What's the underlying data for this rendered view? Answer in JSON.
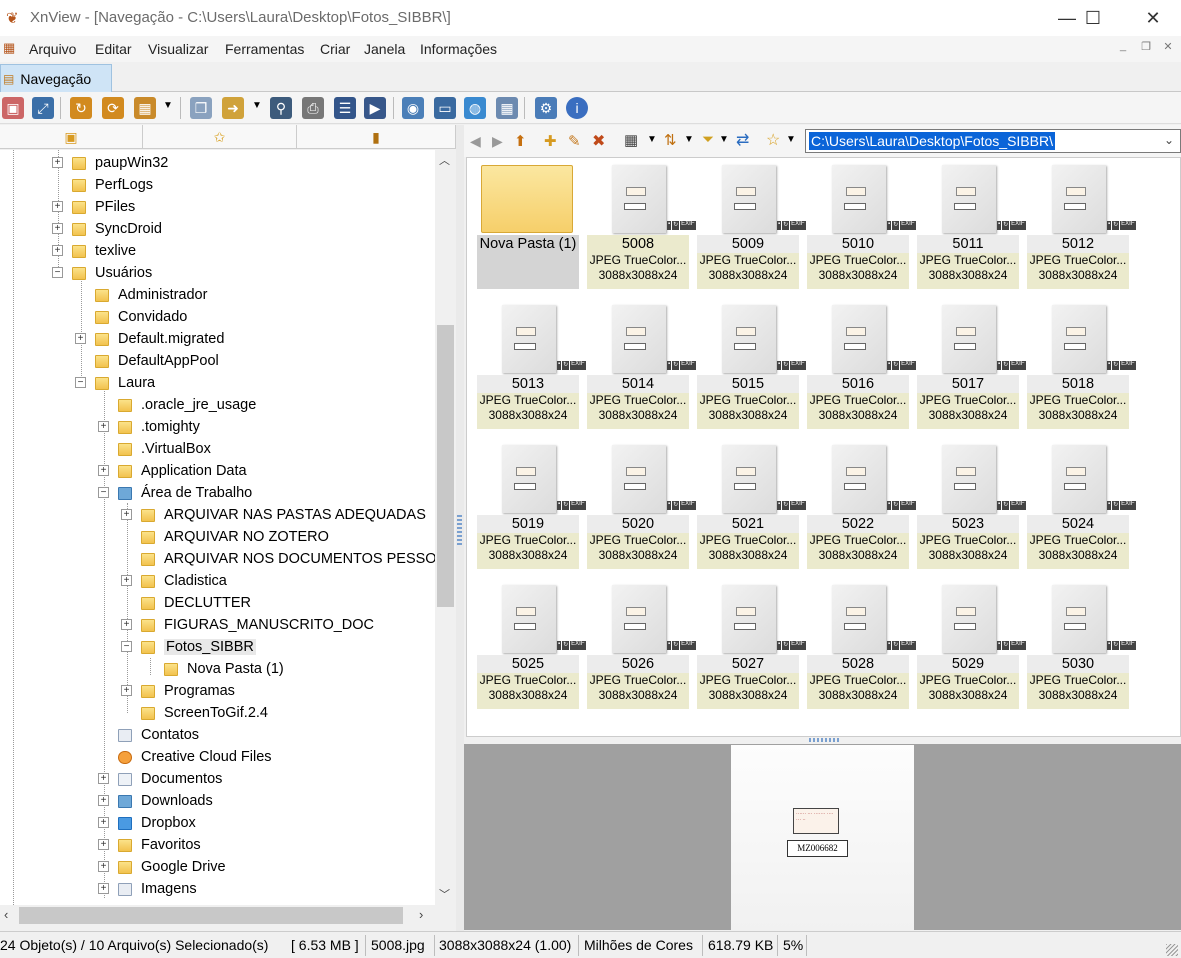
{
  "window": {
    "title": "XnView - [Navegação - C:\\Users\\Laura\\Desktop\\Fotos_SIBBR\\]",
    "minimize": "—",
    "maximize": "☐",
    "close": "✕"
  },
  "menu": [
    "Arquivo",
    "Editar",
    "Visualizar",
    "Ferramentas",
    "Criar",
    "Janela",
    "Informações"
  ],
  "mdi": {
    "minimize": "_",
    "restore": "❐",
    "close": "✕"
  },
  "tab": {
    "label": "Navegação"
  },
  "path": "C:\\Users\\Laura\\Desktop\\Fotos_SIBBR\\",
  "tree": [
    {
      "label": "paupWin32",
      "expander": "+"
    },
    {
      "label": "PerfLogs",
      "expander": ""
    },
    {
      "label": "PFiles",
      "expander": "+"
    },
    {
      "label": "SyncDroid",
      "expander": "+"
    },
    {
      "label": "texlive",
      "expander": "+"
    },
    {
      "label": "Usuários",
      "expander": "−"
    },
    {
      "label": "Administrador",
      "expander": ""
    },
    {
      "label": "Convidado",
      "expander": ""
    },
    {
      "label": "Default.migrated",
      "expander": "+"
    },
    {
      "label": "DefaultAppPool",
      "expander": ""
    },
    {
      "label": "Laura",
      "expander": "−"
    },
    {
      "label": ".oracle_jre_usage",
      "expander": ""
    },
    {
      "label": ".tomighty",
      "expander": "+"
    },
    {
      "label": ".VirtualBox",
      "expander": ""
    },
    {
      "label": "Application Data",
      "expander": "+"
    },
    {
      "label": "Área de Trabalho",
      "expander": "−"
    },
    {
      "label": "ARQUIVAR NAS PASTAS ADEQUADAS",
      "expander": "+"
    },
    {
      "label": "ARQUIVAR NO ZOTERO",
      "expander": ""
    },
    {
      "label": "ARQUIVAR NOS DOCUMENTOS PESSOAIS",
      "expander": ""
    },
    {
      "label": "Cladistica",
      "expander": "+"
    },
    {
      "label": "DECLUTTER",
      "expander": ""
    },
    {
      "label": "FIGURAS_MANUSCRITO_DOC",
      "expander": "+"
    },
    {
      "label": "Fotos_SIBBR",
      "expander": "−"
    },
    {
      "label": "Nova Pasta (1)",
      "expander": ""
    },
    {
      "label": "Programas",
      "expander": "+"
    },
    {
      "label": "ScreenToGif.2.4",
      "expander": ""
    },
    {
      "label": "Contatos",
      "expander": ""
    },
    {
      "label": "Creative Cloud Files",
      "expander": ""
    },
    {
      "label": "Documentos",
      "expander": "+"
    },
    {
      "label": "Downloads",
      "expander": "+"
    },
    {
      "label": "Dropbox",
      "expander": "+"
    },
    {
      "label": "Favoritos",
      "expander": "+"
    },
    {
      "label": "Google Drive",
      "expander": "+"
    },
    {
      "label": "Imagens",
      "expander": "+"
    }
  ],
  "folder_item": {
    "name": "Nova Pasta (1)"
  },
  "files": [
    {
      "name": "5008",
      "type": "JPEG TrueColor...",
      "dims": "3088x3088x24"
    },
    {
      "name": "5009",
      "type": "JPEG TrueColor...",
      "dims": "3088x3088x24"
    },
    {
      "name": "5010",
      "type": "JPEG TrueColor...",
      "dims": "3088x3088x24"
    },
    {
      "name": "5011",
      "type": "JPEG TrueColor...",
      "dims": "3088x3088x24"
    },
    {
      "name": "5012",
      "type": "JPEG TrueColor...",
      "dims": "3088x3088x24"
    },
    {
      "name": "5013",
      "type": "JPEG TrueColor...",
      "dims": "3088x3088x24"
    },
    {
      "name": "5014",
      "type": "JPEG TrueColor...",
      "dims": "3088x3088x24"
    },
    {
      "name": "5015",
      "type": "JPEG TrueColor...",
      "dims": "3088x3088x24"
    },
    {
      "name": "5016",
      "type": "JPEG TrueColor...",
      "dims": "3088x3088x24"
    },
    {
      "name": "5017",
      "type": "JPEG TrueColor...",
      "dims": "3088x3088x24"
    },
    {
      "name": "5018",
      "type": "JPEG TrueColor...",
      "dims": "3088x3088x24"
    },
    {
      "name": "5019",
      "type": "JPEG TrueColor...",
      "dims": "3088x3088x24"
    },
    {
      "name": "5020",
      "type": "JPEG TrueColor...",
      "dims": "3088x3088x24"
    },
    {
      "name": "5021",
      "type": "JPEG TrueColor...",
      "dims": "3088x3088x24"
    },
    {
      "name": "5022",
      "type": "JPEG TrueColor...",
      "dims": "3088x3088x24"
    },
    {
      "name": "5023",
      "type": "JPEG TrueColor...",
      "dims": "3088x3088x24"
    },
    {
      "name": "5024",
      "type": "JPEG TrueColor...",
      "dims": "3088x3088x24"
    },
    {
      "name": "5025",
      "type": "JPEG TrueColor...",
      "dims": "3088x3088x24"
    },
    {
      "name": "5026",
      "type": "JPEG TrueColor...",
      "dims": "3088x3088x24"
    },
    {
      "name": "5027",
      "type": "JPEG TrueColor...",
      "dims": "3088x3088x24"
    },
    {
      "name": "5028",
      "type": "JPEG TrueColor...",
      "dims": "3088x3088x24"
    },
    {
      "name": "5029",
      "type": "JPEG TrueColor...",
      "dims": "3088x3088x24"
    },
    {
      "name": "5030",
      "type": "JPEG TrueColor...",
      "dims": "3088x3088x24"
    }
  ],
  "badge": {
    "exif": "EXIF"
  },
  "preview": {
    "label_text": "MZ006682"
  },
  "status": {
    "objects": "24 Objeto(s) / 10 Arquivo(s) Selecionado(s)",
    "size": "[ 6.53 MB ]",
    "file": "5008.jpg",
    "dims": "3088x3088x24 (1.00)",
    "colors": "Milhões de Cores",
    "filesize": "618.79 KB",
    "zoom": "5%"
  },
  "colors": {
    "accent": "#0a64d8",
    "tab": "#cfe4f6",
    "info_bg": "#ebeacd",
    "preview_bg": "#a0a0a0"
  }
}
